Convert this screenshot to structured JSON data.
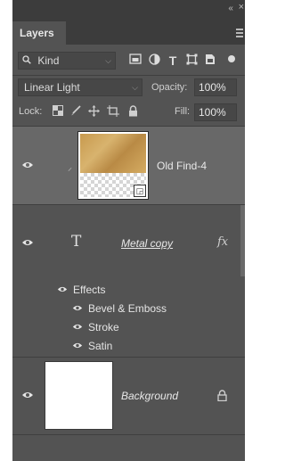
{
  "panel": {
    "tab_label": "Layers",
    "collapse_glyph": "‹‹",
    "close_glyph": "×"
  },
  "filter": {
    "kind_label": "Kind",
    "icons": [
      "image-filter-icon",
      "adjustment-filter-icon",
      "type-filter-icon",
      "shape-filter-icon",
      "smart-object-filter-icon",
      "filter-toggle-icon"
    ]
  },
  "blend": {
    "mode": "Linear Light",
    "opacity_label": "Opacity:",
    "opacity_value": "100%"
  },
  "lock": {
    "label": "Lock:",
    "icons": [
      "lock-transparent-icon",
      "lock-paint-icon",
      "lock-move-icon",
      "lock-artboard-icon",
      "lock-all-icon"
    ],
    "fill_label": "Fill:",
    "fill_value": "100%"
  },
  "layers": [
    {
      "name": "Old Find-4",
      "type": "smart-object",
      "selected": true,
      "visible": true
    },
    {
      "name": "Metal copy",
      "type": "text",
      "selected": false,
      "visible": true,
      "fx": "fx",
      "effects_label": "Effects",
      "effects": [
        "Bevel & Emboss",
        "Stroke",
        "Satin"
      ]
    },
    {
      "name": "Background",
      "type": "pixel",
      "selected": false,
      "visible": true,
      "locked": true
    }
  ],
  "colors": {
    "panel_bg": "#535353",
    "selected_row": "#686868",
    "tab_bar": "#3c3c3c"
  }
}
